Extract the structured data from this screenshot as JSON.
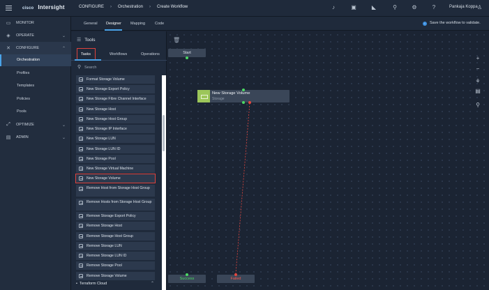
{
  "header": {
    "brand_prefix": "cisco",
    "brand": "Intersight",
    "breadcrumb": [
      "CONFIGURE",
      "Orchestration",
      "Create Workflow"
    ],
    "user_name": "Pankaja Koppa",
    "icons": [
      "bell-icon",
      "clipboard-icon",
      "megaphone-icon",
      "search-icon",
      "gear-icon",
      "help-icon",
      "user-icon"
    ]
  },
  "sidebar": {
    "items": [
      {
        "label": "MONITOR",
        "icon": "monitor-icon"
      },
      {
        "label": "OPERATE",
        "icon": "operate-icon"
      },
      {
        "label": "CONFIGURE",
        "icon": "configure-icon"
      },
      {
        "label": "OPTIMIZE",
        "icon": "optimize-icon"
      },
      {
        "label": "ADMIN",
        "icon": "admin-icon"
      }
    ],
    "subitems": [
      "Orchestration",
      "Profiles",
      "Templates",
      "Policies",
      "Pools"
    ]
  },
  "tabs": [
    "General",
    "Designer",
    "Mapping",
    "Code"
  ],
  "info_message": "Save the workflow to validate.",
  "tools": {
    "title": "Tools",
    "subtabs": [
      "Tasks",
      "Workflows",
      "Operations"
    ],
    "search_placeholder": "Search",
    "tasks": [
      "Format Storage Volume",
      "New Storage Export Policy",
      "New Storage Fibre Channel Interface",
      "New Storage Host",
      "New Storage Host Group",
      "New Storage IP Interface",
      "New Storage LUN",
      "New Storage LUN ID",
      "New Storage Pool",
      "New Storage Virtual Machine",
      "New Storage Volume",
      "Remove Host from Storage Host Group",
      "Remove Hosts from Storage Host Group",
      "Remove Storage Export Policy",
      "Remove Storage Host",
      "Remove Storage Host Group",
      "Remove Storage LUN",
      "Remove Storage LUN ID",
      "Remove Storage Pool",
      "Remove Storage Volume"
    ],
    "section_footer": "Terraform Cloud"
  },
  "canvas": {
    "start_label": "Start",
    "node_title": "New Storage Volume",
    "node_subtitle": "Storage",
    "success_label": "Success",
    "failed_label": "Failed"
  },
  "colors": {
    "accent": "#4aa3e8",
    "highlight": "#e0433d",
    "success": "#4cd964",
    "failed": "#ef5a52",
    "node_icon": "#9cc65a"
  }
}
